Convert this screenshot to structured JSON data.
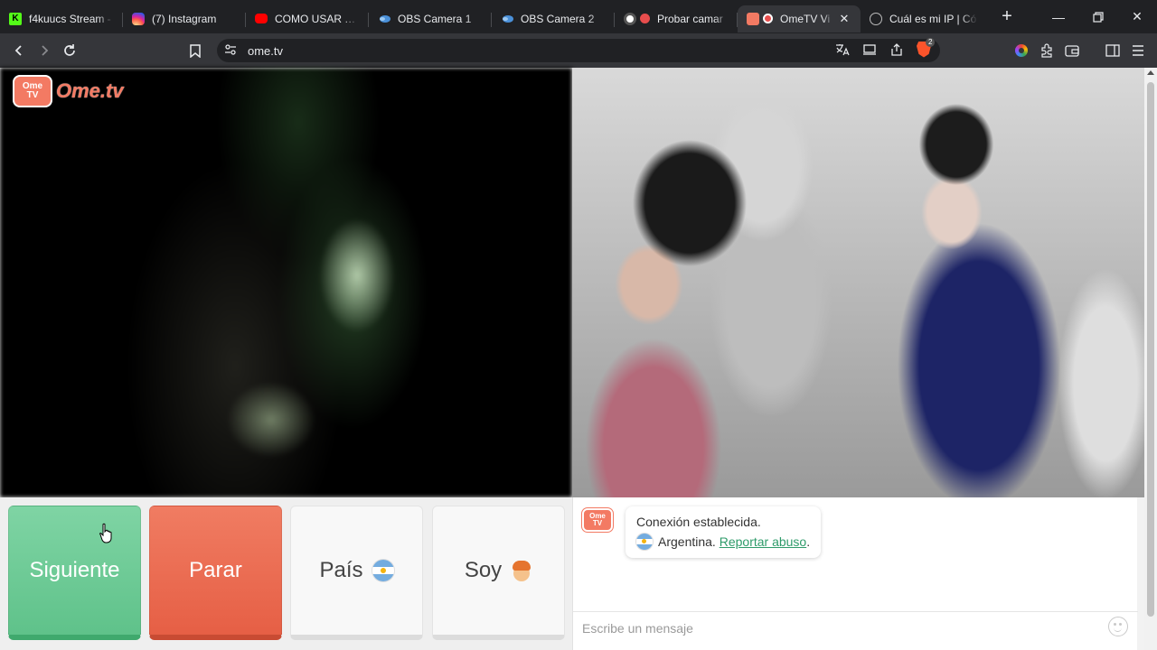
{
  "tabs": [
    {
      "title": "f4kuucs Stream - ",
      "favicon": "kick-icon",
      "glyph": "K"
    },
    {
      "title": "(7) Instagram",
      "favicon": "instagram-icon",
      "glyph": ""
    },
    {
      "title": "COMO USAR TU C",
      "favicon": "youtube-icon",
      "glyph": ""
    },
    {
      "title": "OBS Camera 1",
      "favicon": "obs-icon",
      "glyph": ""
    },
    {
      "title": "OBS Camera 2",
      "favicon": "obs-icon",
      "glyph": ""
    },
    {
      "title": "Probar camar",
      "favicon": "record-icon",
      "glyph": ""
    },
    {
      "title": "OmeTV Vi",
      "favicon": "ometv-icon",
      "glyph": "",
      "active": true
    },
    {
      "title": "Cuál es mi IP | Có",
      "favicon": "globe-icon",
      "glyph": ""
    }
  ],
  "toolbar": {
    "url": "ome.tv",
    "brave_badge": "2"
  },
  "page": {
    "logo_text": "Ome.tv",
    "logo_badge_top": "Ome",
    "logo_badge_bottom": "TV",
    "buttons": {
      "next": "Siguiente",
      "stop": "Parar",
      "country": "País",
      "gender": "Soy"
    },
    "chat": {
      "status": "Conexión establecida.",
      "country": "Argentina.",
      "report_link": "Reportar abuso",
      "report_suffix": ".",
      "input_placeholder": "Escribe un mensaje"
    }
  },
  "colors": {
    "next_button": "#5fc28a",
    "stop_button": "#e65f45",
    "brand": "#f37a63",
    "link": "#2e9b6a"
  }
}
